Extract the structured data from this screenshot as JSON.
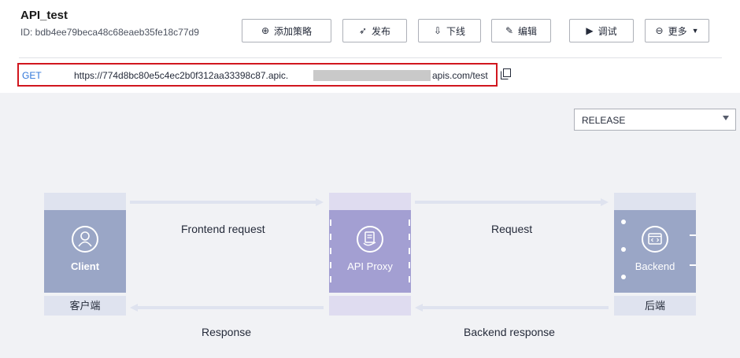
{
  "api": {
    "name": "API_test",
    "id": "ID: bdb4ee79beca48c68eaeb35fe18c77d9"
  },
  "toolbar": {
    "add_policy": "添加策略",
    "publish": "发布",
    "offline": "下线",
    "edit": "编辑",
    "debug": "调试",
    "more": "更多"
  },
  "url": {
    "method": "GET",
    "prefix": "https://774d8bc80e5c4ec2b0f312aa33398c87.apic.",
    "suffix": "apis.com/test"
  },
  "environment": {
    "selected": "RELEASE"
  },
  "flow": {
    "client": {
      "icon_label": "Client",
      "caption": "客户端"
    },
    "proxy": {
      "icon_label": "API Proxy"
    },
    "backend": {
      "icon_label": "Backend",
      "caption": "后端"
    },
    "frontend_request": "Frontend request",
    "request": "Request",
    "response": "Response",
    "backend_response": "Backend response"
  },
  "colors": {
    "accent": "#2e75d9",
    "highlight_border": "#d1161e",
    "client_body": "#9aa6c6",
    "proxy_body": "#a39fd2",
    "backend_body": "#9aa6c6"
  }
}
